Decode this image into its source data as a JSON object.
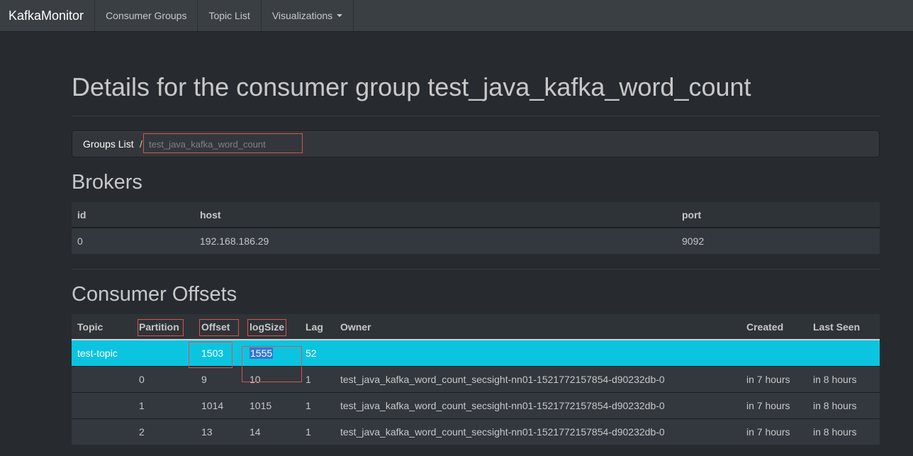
{
  "nav": {
    "brand": "KafkaMonitor",
    "items": [
      "Consumer Groups",
      "Topic List",
      "Visualizations"
    ]
  },
  "page": {
    "title": "Details for the consumer group test_java_kafka_word_count"
  },
  "breadcrumb": {
    "groups_list": "Groups List",
    "separator": "/",
    "current": "test_java_kafka_word_count"
  },
  "brokers": {
    "heading": "Brokers",
    "columns": [
      "id",
      "host",
      "port"
    ],
    "rows": [
      [
        "0",
        "192.168.186.29",
        "9092"
      ]
    ]
  },
  "offsets": {
    "heading": "Consumer Offsets",
    "columns": [
      "Topic",
      "Partition",
      "Offset",
      "logSize",
      "Lag",
      "Owner",
      "Created",
      "Last Seen"
    ],
    "topic_row": {
      "topic": "test-topic",
      "offset": "1503",
      "logsize": "1555",
      "lag": "52"
    },
    "rows": [
      [
        "0",
        "9",
        "10",
        "1",
        "test_java_kafka_word_count_secsight-nn01-1521772157854-d90232db-0",
        "in 7 hours",
        "in 8 hours"
      ],
      [
        "1",
        "1014",
        "1015",
        "1",
        "test_java_kafka_word_count_secsight-nn01-1521772157854-d90232db-0",
        "in 7 hours",
        "in 8 hours"
      ],
      [
        "2",
        "13",
        "14",
        "1",
        "test_java_kafka_word_count_secsight-nn01-1521772157854-d90232db-0",
        "in 7 hours",
        "in 8 hours"
      ]
    ]
  },
  "colors": {
    "background": "#272b30",
    "navbar": "#3a3f44",
    "highlight_row": "#0bc4e0",
    "annotation": "#d9534f",
    "text_selection": "#3375d6"
  }
}
